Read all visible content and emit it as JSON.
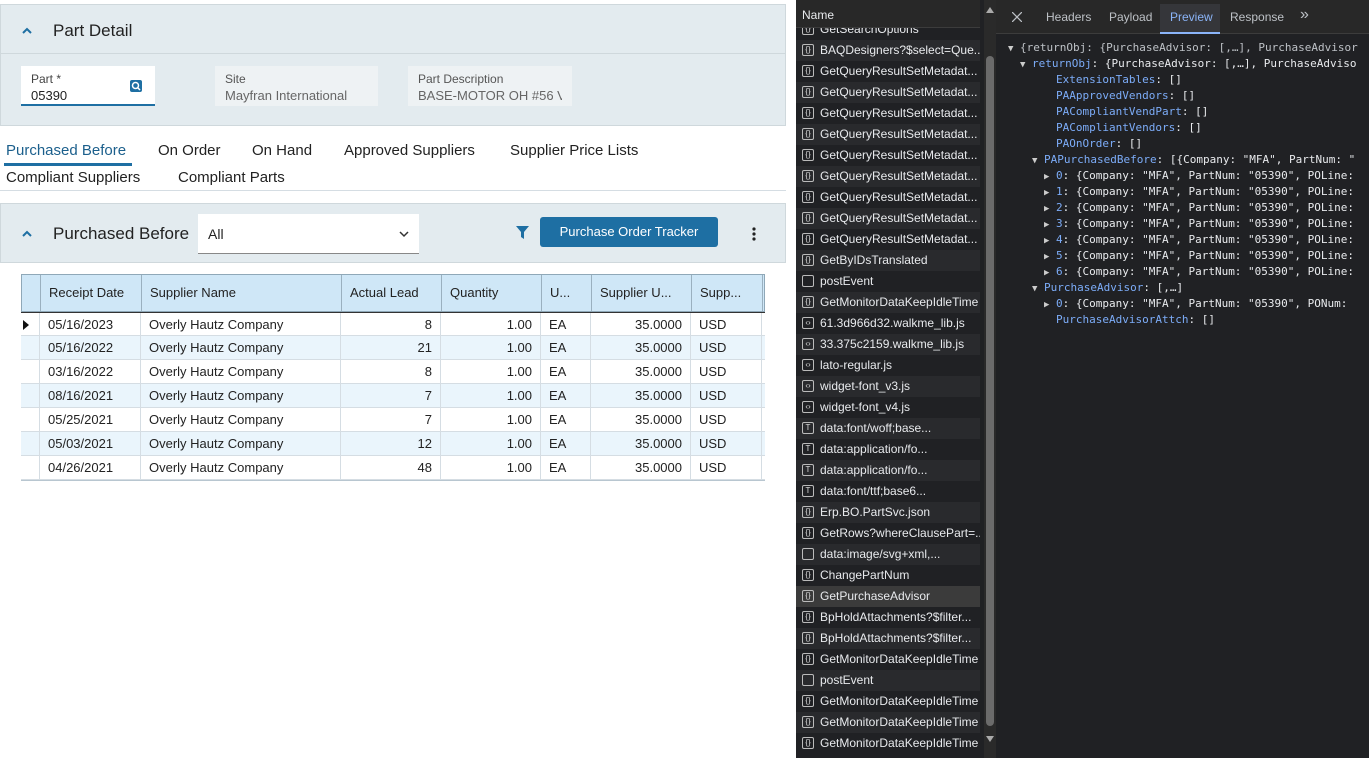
{
  "part_detail": {
    "title": "Part Detail",
    "part_label": "Part *",
    "part_value": "05390",
    "site_label": "Site",
    "site_value": "Mayfran International",
    "desc_label": "Part Description",
    "desc_value": "BASE-MOTOR OH #56 V..."
  },
  "tabs": [
    "Purchased Before",
    "On Order",
    "On Hand",
    "Approved Suppliers",
    "Supplier Price Lists",
    "Compliant Suppliers",
    "Compliant Parts"
  ],
  "purchased": {
    "title": "Purchased Before",
    "filter_value": "All",
    "tracker_button": "Purchase Order Tracker",
    "columns": [
      "Receipt Date",
      "Supplier Name",
      "Actual Lead",
      "Quantity",
      "U...",
      "Supplier U...",
      "Supp..."
    ],
    "rows": [
      [
        "05/16/2023",
        "Overly Hautz Company",
        "8",
        "1.00",
        "EA",
        "35.0000",
        "USD"
      ],
      [
        "05/16/2022",
        "Overly Hautz Company",
        "21",
        "1.00",
        "EA",
        "35.0000",
        "USD"
      ],
      [
        "03/16/2022",
        "Overly Hautz Company",
        "8",
        "1.00",
        "EA",
        "35.0000",
        "USD"
      ],
      [
        "08/16/2021",
        "Overly Hautz Company",
        "7",
        "1.00",
        "EA",
        "35.0000",
        "USD"
      ],
      [
        "05/25/2021",
        "Overly Hautz Company",
        "7",
        "1.00",
        "EA",
        "35.0000",
        "USD"
      ],
      [
        "05/03/2021",
        "Overly Hautz Company",
        "12",
        "1.00",
        "EA",
        "35.0000",
        "USD"
      ],
      [
        "04/26/2021",
        "Overly Hautz Company",
        "48",
        "1.00",
        "EA",
        "35.0000",
        "USD"
      ]
    ]
  },
  "network": {
    "header": "Name",
    "items": [
      {
        "icon": "xhr",
        "label": "GetSearchOptions"
      },
      {
        "icon": "xhr",
        "label": "BAQDesigners?$select=Que..."
      },
      {
        "icon": "xhr",
        "label": "GetQueryResultSetMetadat..."
      },
      {
        "icon": "xhr",
        "label": "GetQueryResultSetMetadat..."
      },
      {
        "icon": "xhr",
        "label": "GetQueryResultSetMetadat..."
      },
      {
        "icon": "xhr",
        "label": "GetQueryResultSetMetadat..."
      },
      {
        "icon": "xhr",
        "label": "GetQueryResultSetMetadat..."
      },
      {
        "icon": "xhr",
        "label": "GetQueryResultSetMetadat..."
      },
      {
        "icon": "xhr",
        "label": "GetQueryResultSetMetadat..."
      },
      {
        "icon": "xhr",
        "label": "GetQueryResultSetMetadat..."
      },
      {
        "icon": "xhr",
        "label": "GetQueryResultSetMetadat..."
      },
      {
        "icon": "xhr",
        "label": "GetByIDsTranslated"
      },
      {
        "icon": "doc",
        "label": "postEvent"
      },
      {
        "icon": "xhr",
        "label": "GetMonitorDataKeepIdleTime"
      },
      {
        "icon": "script",
        "label": "61.3d966d32.walkme_lib.js"
      },
      {
        "icon": "script",
        "label": "33.375c2159.walkme_lib.js"
      },
      {
        "icon": "script",
        "label": "lato-regular.js"
      },
      {
        "icon": "script",
        "label": "widget-font_v3.js"
      },
      {
        "icon": "script",
        "label": "widget-font_v4.js"
      },
      {
        "icon": "font",
        "label": "data:font/woff;base..."
      },
      {
        "icon": "font",
        "label": "data:application/fo..."
      },
      {
        "icon": "font",
        "label": "data:application/fo..."
      },
      {
        "icon": "font",
        "label": "data:font/ttf;base6..."
      },
      {
        "icon": "xhr",
        "label": "Erp.BO.PartSvc.json"
      },
      {
        "icon": "xhr",
        "label": "GetRows?whereClausePart=..."
      },
      {
        "icon": "doc",
        "label": "data:image/svg+xml,..."
      },
      {
        "icon": "xhr",
        "label": "ChangePartNum"
      },
      {
        "icon": "xhr",
        "label": "GetPurchaseAdvisor"
      },
      {
        "icon": "xhr",
        "label": "BpHoldAttachments?$filter..."
      },
      {
        "icon": "xhr",
        "label": "BpHoldAttachments?$filter..."
      },
      {
        "icon": "xhr",
        "label": "GetMonitorDataKeepIdleTime"
      },
      {
        "icon": "doc",
        "label": "postEvent"
      },
      {
        "icon": "xhr",
        "label": "GetMonitorDataKeepIdleTime"
      },
      {
        "icon": "xhr",
        "label": "GetMonitorDataKeepIdleTime"
      },
      {
        "icon": "xhr",
        "label": "GetMonitorDataKeepIdleTime"
      }
    ]
  },
  "preview": {
    "tabs": [
      "Headers",
      "Payload",
      "Preview",
      "Response"
    ],
    "lines": [
      {
        "tri": "▼",
        "text": "{returnObj: {PurchaseAdvisor: [,…], PurchaseAdvisor"
      },
      {
        "tri": "▼",
        "key": "returnObj",
        "text": ": {PurchaseAdvisor: [,…], PurchaseAdviso"
      },
      {
        "tri": "",
        "key": "ExtensionTables",
        "text": ": []"
      },
      {
        "tri": "",
        "key": "PAApprovedVendors",
        "text": ": []"
      },
      {
        "tri": "",
        "key": "PACompliantVendPart",
        "text": ": []"
      },
      {
        "tri": "",
        "key": "PACompliantVendors",
        "text": ": []"
      },
      {
        "tri": "",
        "key": "PAOnOrder",
        "text": ": []"
      },
      {
        "tri": "▼",
        "key": "PAPurchasedBefore",
        "text": ": [{Company: \"MFA\", PartNum: \""
      },
      {
        "tri": "▶",
        "key": "0",
        "text": ": {Company: \"MFA\", PartNum: \"05390\", POLine:"
      },
      {
        "tri": "▶",
        "key": "1",
        "text": ": {Company: \"MFA\", PartNum: \"05390\", POLine:"
      },
      {
        "tri": "▶",
        "key": "2",
        "text": ": {Company: \"MFA\", PartNum: \"05390\", POLine:"
      },
      {
        "tri": "▶",
        "key": "3",
        "text": ": {Company: \"MFA\", PartNum: \"05390\", POLine:"
      },
      {
        "tri": "▶",
        "key": "4",
        "text": ": {Company: \"MFA\", PartNum: \"05390\", POLine:"
      },
      {
        "tri": "▶",
        "key": "5",
        "text": ": {Company: \"MFA\", PartNum: \"05390\", POLine:"
      },
      {
        "tri": "▶",
        "key": "6",
        "text": ": {Company: \"MFA\", PartNum: \"05390\", POLine:"
      },
      {
        "tri": "▼",
        "key": "PurchaseAdvisor",
        "text": ": [,…]"
      },
      {
        "tri": "▶",
        "key": "0",
        "text": ": {Company: \"MFA\", PartNum: \"05390\", PONum:"
      },
      {
        "tri": "",
        "key": "PurchaseAdvisorAttch",
        "text": ": []"
      }
    ]
  },
  "colors": {
    "accent": "#1e6fa3",
    "header_bg": "#e3ebef",
    "grid_header": "#cfe7f7",
    "devtools_bg": "#202124"
  }
}
